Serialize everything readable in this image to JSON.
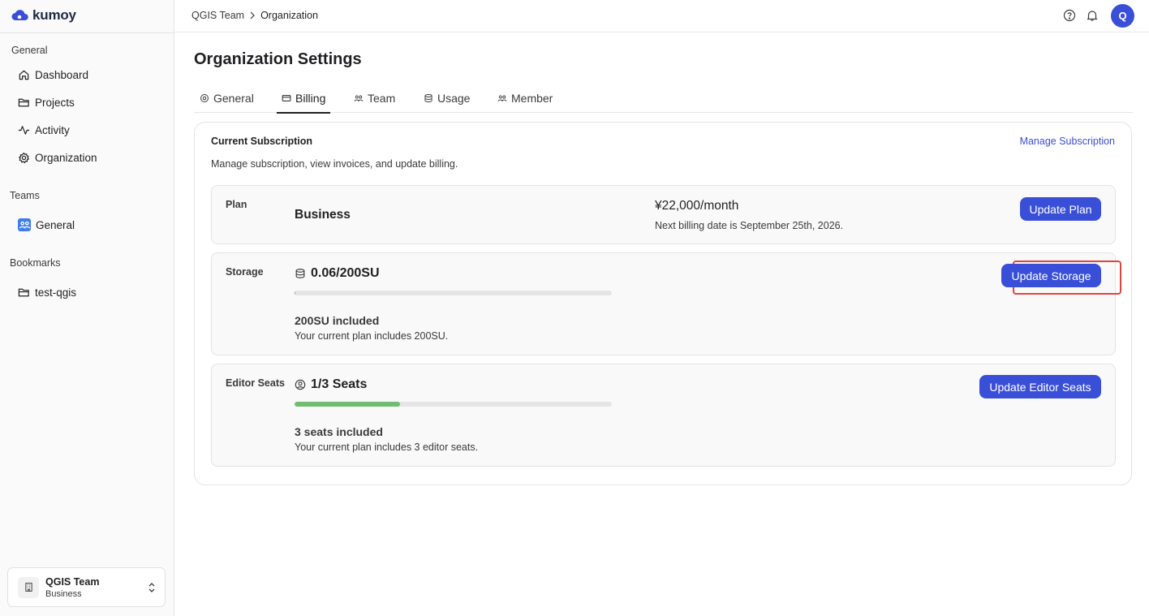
{
  "app": {
    "logo_text": "kumoy"
  },
  "sidebar": {
    "sections": [
      {
        "label": "General"
      },
      {
        "label": "Teams"
      },
      {
        "label": "Bookmarks"
      }
    ],
    "general_items": [
      {
        "label": "Dashboard",
        "icon": "home-icon"
      },
      {
        "label": "Projects",
        "icon": "folder-icon"
      },
      {
        "label": "Activity",
        "icon": "activity-icon"
      },
      {
        "label": "Organization",
        "icon": "gear-icon"
      }
    ],
    "team_items": [
      {
        "label": "General",
        "icon": "team-icon"
      }
    ],
    "bookmark_items": [
      {
        "label": "test-qgis",
        "icon": "folder-icon"
      }
    ],
    "footer": {
      "name": "QGIS Team",
      "plan": "Business"
    }
  },
  "header": {
    "breadcrumb": [
      "QGIS Team",
      "Organization"
    ],
    "avatar_initial": "Q"
  },
  "page": {
    "title": "Organization Settings",
    "tabs": [
      {
        "label": "General",
        "active": false
      },
      {
        "label": "Billing",
        "active": true
      },
      {
        "label": "Team",
        "active": false
      },
      {
        "label": "Usage",
        "active": false
      },
      {
        "label": "Member",
        "active": false
      }
    ]
  },
  "subscription": {
    "title": "Current Subscription",
    "manage_link": "Manage Subscription",
    "description": "Manage subscription, view invoices, and update billing.",
    "plan": {
      "label": "Plan",
      "name": "Business",
      "price": "¥22,000/month",
      "next_billing": "Next billing date is September 25th, 2026.",
      "button": "Update Plan"
    },
    "storage": {
      "label": "Storage",
      "value": "0.06/200SU",
      "progress": 0.0003,
      "included": "200SU included",
      "included_sub": "Your current plan includes 200SU.",
      "button": "Update Storage"
    },
    "seats": {
      "label": "Editor Seats",
      "value": "1/3 Seats",
      "progress": 0.3333,
      "included": "3 seats included",
      "included_sub": "Your current plan includes 3 editor seats.",
      "button": "Update Editor Seats"
    }
  },
  "colors": {
    "accent": "#3a4fd8",
    "progress_fill": "#6fbd6f",
    "highlight": "#e0443e"
  }
}
